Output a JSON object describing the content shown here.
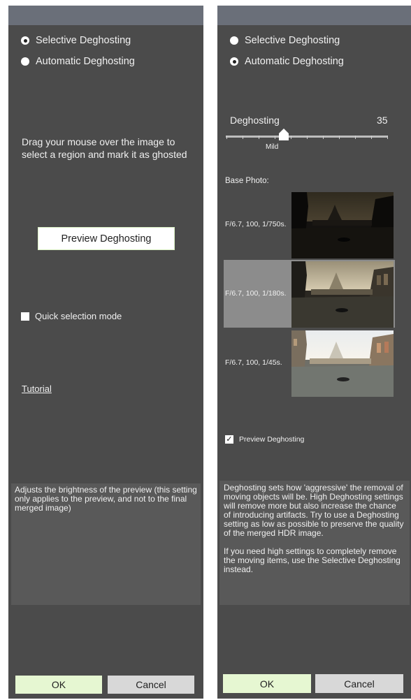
{
  "left": {
    "options": [
      {
        "label": "Selective Deghosting",
        "checked": true
      },
      {
        "label": "Automatic Deghosting",
        "checked": false
      }
    ],
    "instructions": "Drag your mouse over the image to select a region and mark it as ghosted",
    "preview_button": "Preview Deghosting",
    "quick_selection_label": "Quick selection mode",
    "quick_selection_checked": false,
    "tutorial_link": "Tutorial",
    "help_text": "Adjusts the brightness of the preview (this setting only applies to the preview, and not to the final merged image)",
    "ok_label": "OK",
    "cancel_label": "Cancel"
  },
  "right": {
    "options": [
      {
        "label": "Selective Deghosting",
        "checked": false
      },
      {
        "label": "Automatic Deghosting",
        "checked": true
      }
    ],
    "deghosting_label": "Deghosting",
    "deghosting_value": "35",
    "slider_level_label": "Mild",
    "base_photo_label": "Base Photo:",
    "photos": [
      {
        "label": "F/6.7, 100, 1/750s.",
        "selected": false
      },
      {
        "label": "F/6.7, 100, 1/180s.",
        "selected": true
      },
      {
        "label": "F/6.7, 100, 1/45s.",
        "selected": false
      }
    ],
    "preview_label": "Preview Deghosting",
    "preview_checked": true,
    "help_text_1": "Deghosting sets how 'aggressive' the removal of moving objects will be. High Deghosting settings will remove more but also increase the chance of introducing artifacts. Try to use a Deghosting setting as low as possible to preserve the quality of the merged HDR image.",
    "help_text_2": "If you need high settings to completely remove the moving items, use the Selective Deghosting instead.",
    "ok_label": "OK",
    "cancel_label": "Cancel"
  },
  "colors": {
    "panel_bg": "#4b4b4b",
    "title_bar": "#6a6f79",
    "ok_button": "#e6f7d2",
    "cancel_button": "#d8d8d8",
    "selected_row": "#8c8c8c"
  }
}
